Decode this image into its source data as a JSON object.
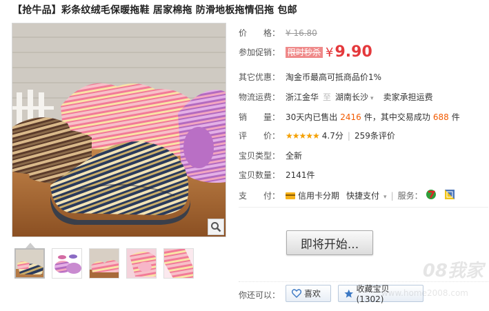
{
  "title": "【抢牛品】彩条纹绒毛保暖拖鞋 居家棉拖 防滑地板拖情侣拖 包邮",
  "price": {
    "label": "价　　格：",
    "original": "¥ 16.80"
  },
  "promo": {
    "label": "参加促销：",
    "tag": "限时秒杀",
    "currency": "¥",
    "value": "9.90"
  },
  "other": {
    "label": "其它优惠：",
    "text": "淘金币最高可抵商品价1%"
  },
  "shipping": {
    "label": "物流运费：",
    "from": "浙江金华",
    "divider": "至",
    "to": "湖南长沙",
    "fee": "卖家承担运费"
  },
  "sales": {
    "label": "销　　量：",
    "prefix": "30天内已售出",
    "count": "2416",
    "mid": "件，其中交易成功",
    "success": "688",
    "suffix": "件"
  },
  "rating": {
    "label": "评　　价：",
    "stars": "★★★★★",
    "score": "4.7分",
    "reviews": "259条评价"
  },
  "type": {
    "label": "宝贝类型：",
    "value": "全新"
  },
  "stock": {
    "label": "宝贝数量：",
    "value": "2141件"
  },
  "payment": {
    "label": "支　　付：",
    "credit": "信用卡分期",
    "quick": "快捷支付",
    "service_label": "服务："
  },
  "start_button": "即将开始...",
  "actions": {
    "label": "你还可以：",
    "like": "喜欢",
    "collect": "收藏宝贝 (1302)"
  },
  "watermark": {
    "main": "08我家",
    "sub": "www.home2008.com"
  },
  "colors": {
    "price_red": "#e4393c",
    "orange": "#f25a00",
    "star": "#f4a000"
  }
}
